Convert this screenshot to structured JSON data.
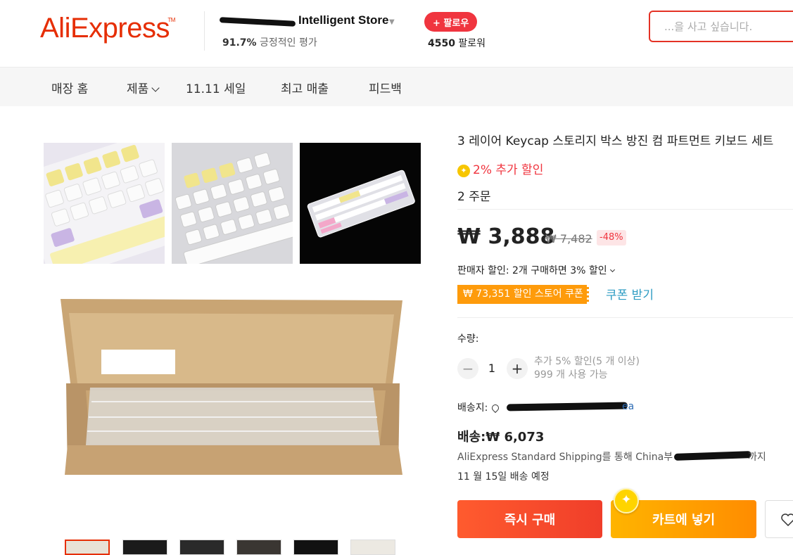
{
  "header": {
    "logo": "AliExpress",
    "logo_tm": "TM",
    "store_name": "Intelligent Store",
    "store_rating_value": "91.7%",
    "store_rating_label": "긍정적인 평가",
    "follow_label": "+ 팔로우",
    "followers_count": "4550",
    "followers_label": "팔로워",
    "search_placeholder": "...을 사고 싶습니다."
  },
  "nav": {
    "items": [
      {
        "label": "매장 홈"
      },
      {
        "label": "제품"
      },
      {
        "label": "11.11 세일"
      },
      {
        "label": "최고 매출"
      },
      {
        "label": "피드백"
      }
    ]
  },
  "product": {
    "title": "3 레이어 Keycap 스토리지 박스 방진 컴 파트먼트 키보드 세트",
    "extra_discount": "2% 추가 할인",
    "orders": "2 주문",
    "price": "₩ 3,888",
    "original_price": "₩ 7,482",
    "discount_badge": "-48%",
    "seller_discount": "판매자 할인: 2개 구매하면 3% 할인",
    "coupon_tag": "₩ 73,351 할인 스토어 쿠폰",
    "coupon_link": "쿠폰 받기",
    "quantity_label": "수량:",
    "quantity_value": "1",
    "quantity_note_1": "추가 5% 할인(5 개 이상)",
    "quantity_note_2": "999 개 사용 가능",
    "ship_to_label": "배송지:",
    "ship_to_tail": "ea",
    "shipping_fee": "배송:₩ 6,073",
    "shipping_via": "AliExpress Standard Shipping를 통해 China부",
    "shipping_via_tail": "까지",
    "eta": "11 월 15일 배송 예정",
    "buy_now": "즉시 구매",
    "add_to_cart": "카트에 넣기"
  },
  "colors": {
    "brand": "#e62e04",
    "price_red": "#f0353f",
    "coupon_orange": "#fe9b0b",
    "link_blue": "#2e9cc3"
  }
}
